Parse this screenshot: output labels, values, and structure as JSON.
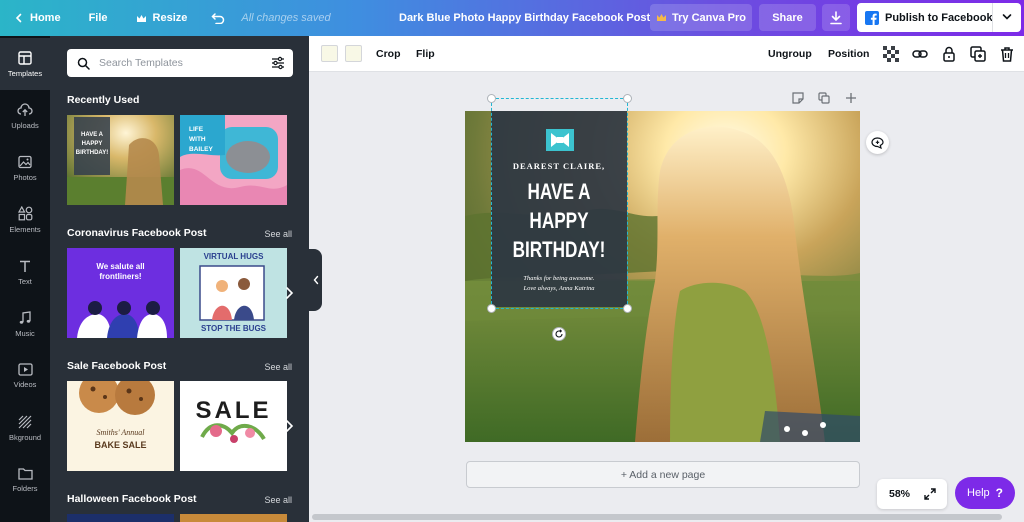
{
  "topbar": {
    "home_label": "Home",
    "file_label": "File",
    "resize_label": "Resize",
    "saved_status": "All changes saved",
    "doc_title": "Dark Blue Photo Happy Birthday Facebook Post",
    "try_pro_label": "Try Canva Pro",
    "share_label": "Share",
    "publish_label": "Publish to Facebook"
  },
  "rail": {
    "items": [
      {
        "label": "Templates",
        "icon": "templates-icon"
      },
      {
        "label": "Uploads",
        "icon": "uploads-icon"
      },
      {
        "label": "Photos",
        "icon": "photos-icon"
      },
      {
        "label": "Elements",
        "icon": "elements-icon"
      },
      {
        "label": "Text",
        "icon": "text-icon"
      },
      {
        "label": "Music",
        "icon": "music-icon"
      },
      {
        "label": "Videos",
        "icon": "videos-icon"
      },
      {
        "label": "Bkground",
        "icon": "background-icon"
      },
      {
        "label": "Folders",
        "icon": "folders-icon"
      }
    ]
  },
  "panel": {
    "search_placeholder": "Search Templates",
    "see_all": "See all",
    "sections": [
      {
        "title": "Recently Used"
      },
      {
        "title": "Coronavirus Facebook Post"
      },
      {
        "title": "Sale Facebook Post"
      },
      {
        "title": "Halloween Facebook Post"
      }
    ],
    "thumbs": {
      "recent1": {
        "l1": "HAVE A",
        "l2": "HAPPY",
        "l3": "BIRTHDAY!"
      },
      "recent2": {
        "l1": "LIFE",
        "l2": "WITH",
        "l3": "BAILEY"
      },
      "corona1": {
        "l1": "We salute all",
        "l2": "frontliners!"
      },
      "corona2": {
        "top": "VIRTUAL HUGS",
        "bottom": "STOP THE BUGS"
      },
      "sale1": {
        "l1": "Smiths' Annual",
        "l2": "BAKE SALE"
      },
      "sale2": {
        "word": "SALE"
      }
    }
  },
  "canvas_toolbar": {
    "crop": "Crop",
    "flip": "Flip",
    "ungroup": "Ungroup",
    "position": "Position"
  },
  "design": {
    "greeting": "DEAREST CLAIRE,",
    "line1": "HAVE A",
    "line2": "HAPPY",
    "line3": "BIRTHDAY!",
    "note1": "Thanks for being awesome.",
    "note2": "Love always, Anna Katrina"
  },
  "canvas": {
    "add_page": "+ Add a new page",
    "zoom": "58%",
    "help": "Help"
  },
  "colors": {
    "brand_purple": "#7d2ae8",
    "dark_panel": "#293039",
    "rail_bg": "#0e1318",
    "bow": "#3cc3cf"
  }
}
